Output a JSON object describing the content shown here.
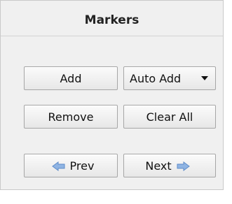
{
  "panel": {
    "title": "Markers"
  },
  "buttons": {
    "add": "Add",
    "auto_add": "Auto Add",
    "remove": "Remove",
    "clear_all": "Clear All",
    "prev": "Prev",
    "next": "Next"
  },
  "icons": {
    "prev": "left-arrow-icon",
    "next": "right-arrow-icon",
    "dropdown": "chevron-down-icon",
    "arrow_color": "#8fb4e3"
  }
}
